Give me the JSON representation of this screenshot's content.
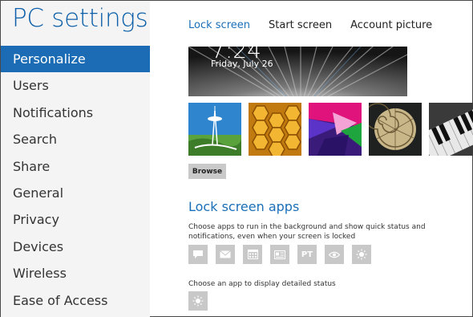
{
  "app": {
    "title": "PC settings"
  },
  "sidebar": {
    "items": [
      {
        "label": "Personalize",
        "active": true
      },
      {
        "label": "Users"
      },
      {
        "label": "Notifications"
      },
      {
        "label": "Search"
      },
      {
        "label": "Share"
      },
      {
        "label": "General"
      },
      {
        "label": "Privacy"
      },
      {
        "label": "Devices"
      },
      {
        "label": "Wireless"
      },
      {
        "label": "Ease of Access"
      }
    ]
  },
  "main": {
    "tabs": [
      {
        "label": "Lock screen",
        "active": true
      },
      {
        "label": "Start screen"
      },
      {
        "label": "Account picture"
      }
    ],
    "preview": {
      "time": "7:24",
      "date": "Friday, July 26"
    },
    "thumbnails": [
      {
        "name": "space-needle"
      },
      {
        "name": "honeycomb"
      },
      {
        "name": "geometric"
      },
      {
        "name": "nautilus"
      },
      {
        "name": "piano"
      }
    ],
    "browse_label": "Browse",
    "lock_apps": {
      "title": "Lock screen apps",
      "description": "Choose apps to run in the background and show quick status and notifications, even when your screen is locked",
      "slots": [
        {
          "icon": "message-icon"
        },
        {
          "icon": "mail-icon"
        },
        {
          "icon": "calendar-icon"
        },
        {
          "icon": "news-icon"
        },
        {
          "icon": "pt-icon",
          "text": "PT"
        },
        {
          "icon": "eye-icon"
        },
        {
          "icon": "weather-icon"
        }
      ],
      "detail_label": "Choose an app to display detailed status",
      "detail_slot": {
        "icon": "weather-icon"
      }
    }
  },
  "colors": {
    "accent": "#1a6fb7",
    "sidebar_bg": "#f4f4f4",
    "active_item": "#1c6cb5",
    "slot_gray": "#c8c8c8"
  }
}
